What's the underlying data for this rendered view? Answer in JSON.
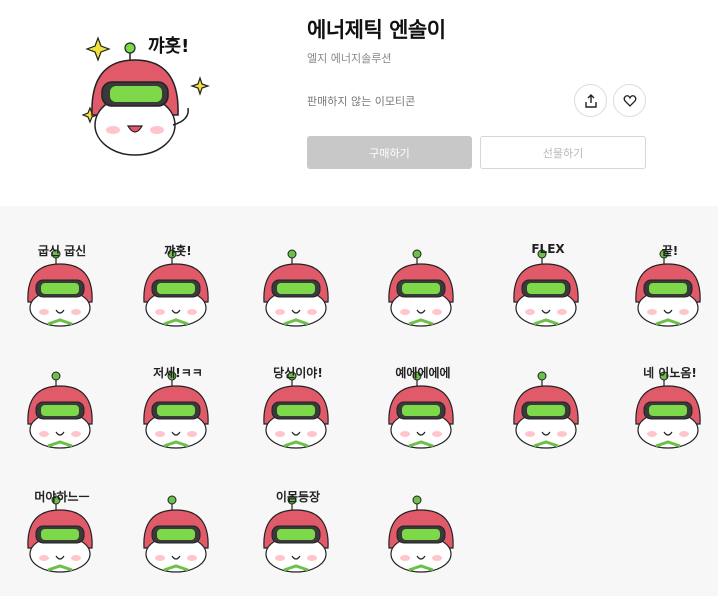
{
  "product": {
    "title": "에너제틱 엔솔이",
    "author": "엘지 에너지솔루션",
    "status": "판매하지 않는 이모티콘",
    "buy_label": "구매하기",
    "gift_label": "선물하기",
    "share_icon": "share-icon",
    "like_icon": "heart-icon"
  },
  "main_sticker_caption": "꺄홋!",
  "stickers": [
    {
      "caption": "굽신    굽신"
    },
    {
      "caption": "꺄홋!"
    },
    {
      "caption": ""
    },
    {
      "caption": ""
    },
    {
      "caption": "FLEX"
    },
    {
      "caption": "끝!"
    },
    {
      "caption": ""
    },
    {
      "caption": "저세!ㅋㅋ"
    },
    {
      "caption": "당신이야!"
    },
    {
      "caption": "예에에에에"
    },
    {
      "caption": ""
    },
    {
      "caption": "네 이노옴!"
    },
    {
      "caption": "머야하느ㅡ"
    },
    {
      "caption": ""
    },
    {
      "caption": "이몸등장"
    },
    {
      "caption": ""
    }
  ],
  "colors": {
    "helmet": "#e05a6a",
    "goggle": "#7dd84a",
    "leaf": "#6cc04a",
    "face": "#ffffff",
    "disabled_button": "#c8c8c8"
  }
}
